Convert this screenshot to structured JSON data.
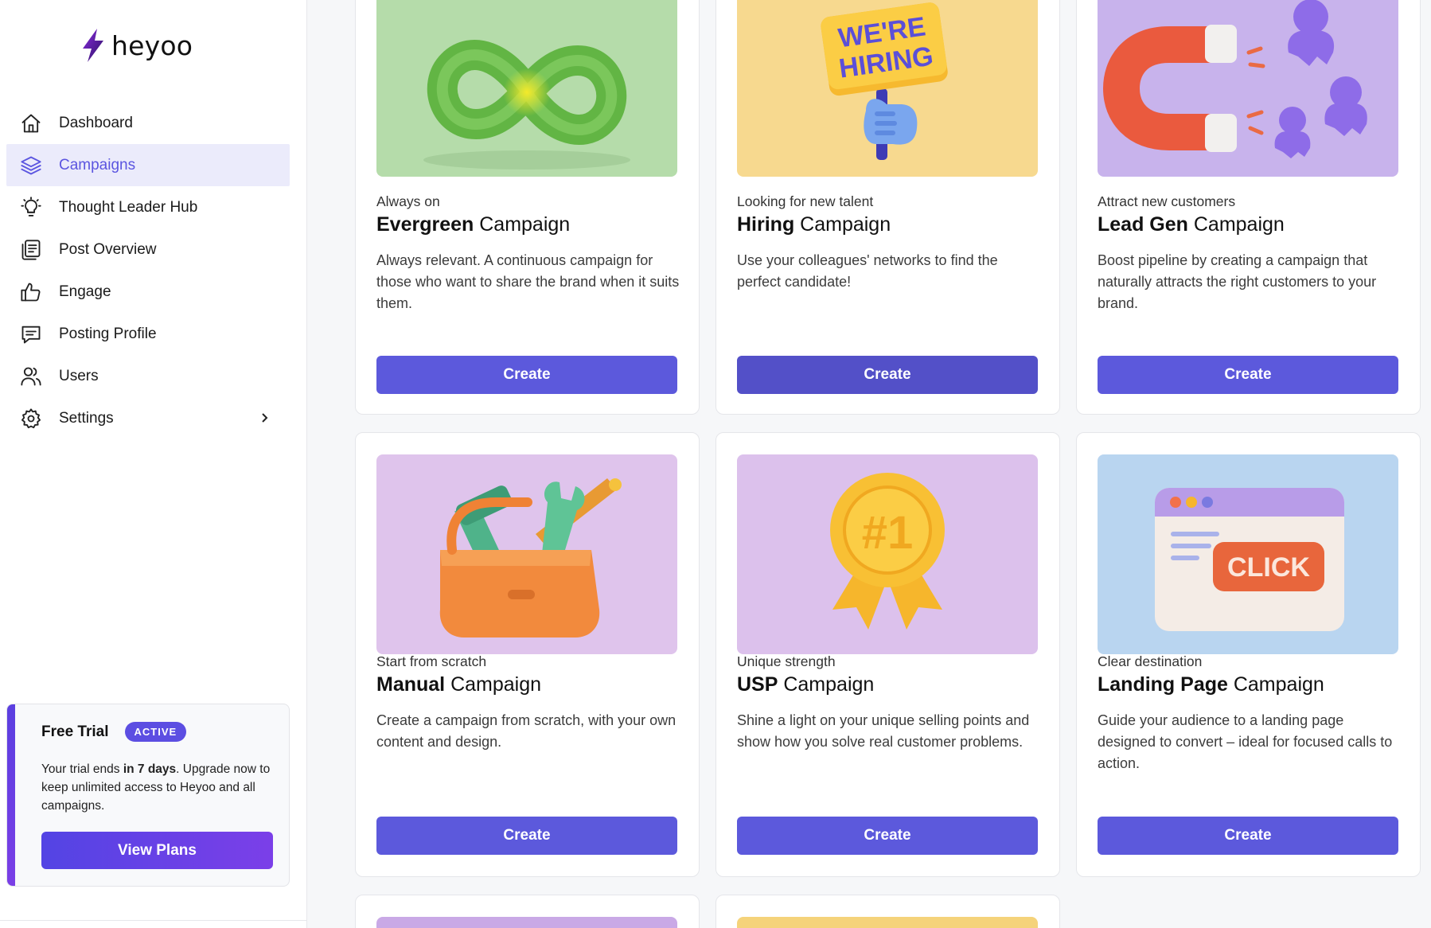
{
  "app": {
    "logo_text": "heyoo"
  },
  "sidebar": {
    "items": [
      {
        "label": "Dashboard",
        "icon": "home-icon"
      },
      {
        "label": "Campaigns",
        "icon": "layers-icon",
        "active": true
      },
      {
        "label": "Thought Leader Hub",
        "icon": "lightbulb-icon"
      },
      {
        "label": "Post Overview",
        "icon": "documents-icon"
      },
      {
        "label": "Engage",
        "icon": "thumbs-up-icon"
      },
      {
        "label": "Posting Profile",
        "icon": "message-icon"
      },
      {
        "label": "Users",
        "icon": "users-icon"
      },
      {
        "label": "Settings",
        "icon": "gear-icon",
        "has_submenu": true
      }
    ]
  },
  "trial": {
    "title": "Free Trial",
    "badge": "ACTIVE",
    "text_before": "Your trial ends ",
    "text_bold": "in 7 days",
    "text_after": ". Upgrade now to keep unlimited access to Heyoo and all campaigns.",
    "button": "View Plans"
  },
  "campaigns": [
    {
      "eyebrow": "Always on",
      "title_bold": "Evergreen",
      "title_rest": " Campaign",
      "description": "Always relevant. A continuous campaign for those who want to share the brand when it suits them.",
      "button": "Create",
      "image": "infinity-illustration",
      "bg": "#b5dcaa"
    },
    {
      "eyebrow": "Looking for new talent",
      "title_bold": "Hiring",
      "title_rest": " Campaign",
      "description": "Use your colleagues' networks to find the perfect candidate!",
      "button": "Create",
      "image": "were-hiring-sign-illustration",
      "image_text_1": "WE'RE",
      "image_text_2": "HIRING",
      "bg": "#f7d98f"
    },
    {
      "eyebrow": "Attract new customers",
      "title_bold": "Lead Gen",
      "title_rest": " Campaign",
      "description": "Boost pipeline by creating a campaign that naturally attracts the right customers to your brand.",
      "button": "Create",
      "image": "magnet-illustration",
      "bg": "#c8b3ec"
    },
    {
      "eyebrow": "Start from scratch",
      "title_bold": "Manual",
      "title_rest": " Campaign",
      "description": "Create a campaign from scratch, with your own content and design.",
      "button": "Create",
      "image": "toolbox-illustration",
      "bg": "#dfc4ec"
    },
    {
      "eyebrow": "Unique strength",
      "title_bold": "USP",
      "title_rest": " Campaign",
      "description": "Shine a light on your unique selling points and show how you solve real customer problems.",
      "button": "Create",
      "image": "award-badge-illustration",
      "image_text_1": "#1",
      "bg": "#dcc1ec"
    },
    {
      "eyebrow": "Clear destination",
      "title_bold": "Landing Page",
      "title_rest": " Campaign",
      "description": "Guide your audience to a landing page designed to convert – ideal for focused calls to action.",
      "button": "Create",
      "image": "click-window-illustration",
      "image_text_1": "CLICK",
      "bg": "#b9d5f0"
    }
  ]
}
